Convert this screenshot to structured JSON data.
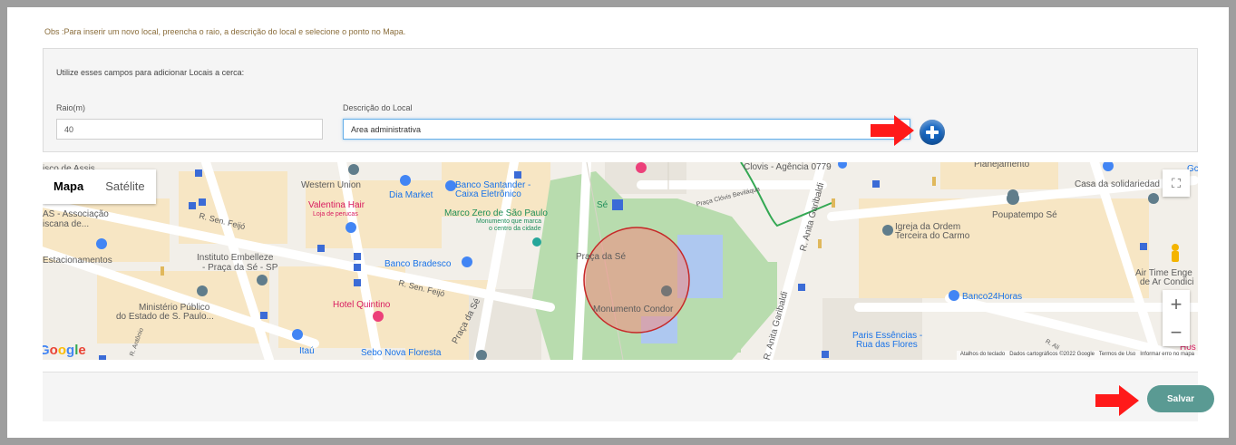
{
  "obs_text": "Obs :Para inserir um novo local, preencha o raio, a descrição do local e selecione o ponto no Mapa.",
  "panel": {
    "title": "Utilize esses campos para adicionar Locais a cerca:",
    "raio_label": "Raio(m)",
    "raio_value": "40",
    "descricao_label": "Descrição do Local",
    "descricao_value": "Area administrativa"
  },
  "map": {
    "type_map": "Mapa",
    "type_satellite": "Satélite",
    "zoom_in": "+",
    "zoom_out": "−",
    "google_logo": "Google",
    "attribution": {
      "shortcuts": "Atalhos do teclado",
      "data": "Dados cartográficos ©2022 Google",
      "terms": "Termos de Uso",
      "report": "Informar erro no mapa"
    },
    "labels": {
      "l1": "isco de Assis",
      "l2": "AS - Associação",
      "l3": "iscana de...",
      "l4": "Estacionamentos",
      "l5": "Western Union",
      "l6": "Valentina Hair",
      "l7": "Loja de perucas",
      "l8": "Dia Market",
      "l9": "Banco Santander -",
      "l10": "Caixa Eletrônico",
      "l11": "Marco Zero de São Paulo",
      "l12": "Monumento que marca",
      "l13": "o centro da cidade",
      "l14": "Sé",
      "l15": "Praça Clóvis Beviláqua",
      "l16": "Clovis - Agência 0779",
      "l17": "Planejamento",
      "l18": "Casa da solidariedad",
      "l19": "Poupatempo Sé",
      "l20": "Igreja da Ordem",
      "l21": "Terceira do Carmo",
      "l22": "R. Sen. Feijó",
      "l23": "Instituto Embelleze",
      "l24": "- Praça da Sé - SP",
      "l25": "Banco Bradesco",
      "l26": "R. Sen. Feijó",
      "l27": "Praça da Sé",
      "l28": "Ministério Público",
      "l29": "do Estado de S. Paulo...",
      "l30": "Hotel Quintino",
      "l31": "Praça da Sé",
      "l32": "Monumento Condor",
      "l33": "R. Anita Garibaldi",
      "l34": "R. Anita Garibaldi",
      "l35": "Banco24Horas",
      "l36": "Air Time Enge",
      "l37": "de Ar Condici",
      "l38": "Paris Essências -",
      "l39": "Rua das Flores",
      "l40": "Itaú",
      "l41": "Sebo Nova Floresta",
      "l42": "R. Antônio",
      "l43": "R. Ali",
      "l44": "Hos",
      "l45": "Gc"
    }
  },
  "save_label": "Salvar",
  "colors": {
    "arrow": "#ff1a1a",
    "save_button": "#5a9a93",
    "plus_button": "#1565c0",
    "circle_fill": "#f28b82",
    "circle_stroke": "#c62828"
  }
}
